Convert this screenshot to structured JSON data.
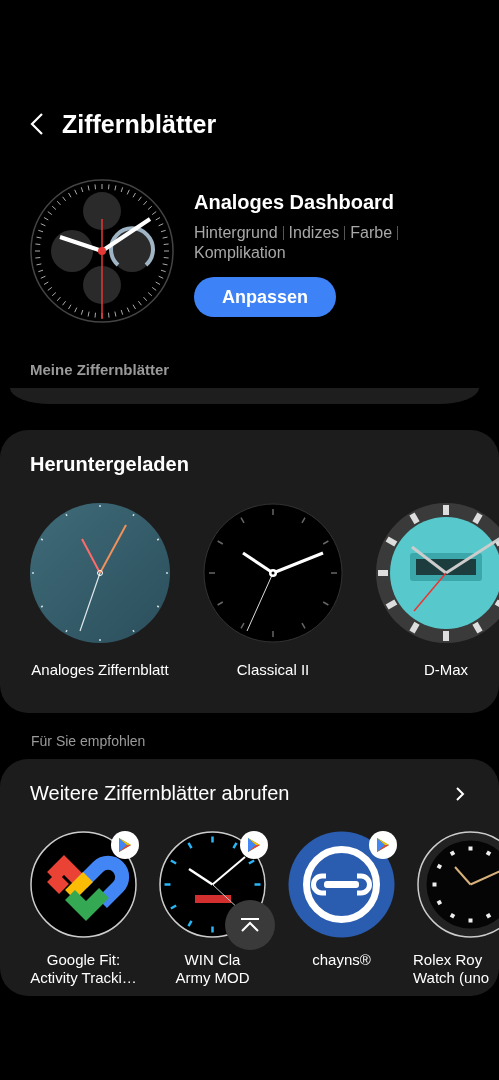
{
  "header": {
    "title": "Ziffernblätter"
  },
  "current": {
    "name": "Analoges Dashboard",
    "options": [
      "Hintergrund",
      "Indizes",
      "Farbe",
      "Komplikation"
    ],
    "button": "Anpassen"
  },
  "my_faces": {
    "heading": "Meine Ziffernblätter"
  },
  "downloaded": {
    "heading": "Heruntergeladen",
    "faces": [
      {
        "name": "Analoges Ziffernblatt",
        "kind": "teal"
      },
      {
        "name": "Classical II",
        "kind": "black"
      },
      {
        "name": "D-Max",
        "kind": "digital"
      }
    ]
  },
  "recommended": {
    "heading": "Für Sie empfohlen",
    "title": "Weitere Ziffernblätter abrufen",
    "apps": [
      {
        "lines": [
          "Google Fit:",
          "Activity Tracki…"
        ],
        "kind": "fit"
      },
      {
        "lines": [
          "WIN Cla",
          "Army MOD"
        ],
        "kind": "sport"
      },
      {
        "lines": [
          "chayns®"
        ],
        "kind": "chain"
      },
      {
        "lines": [
          "Rolex Roy",
          "Watch (uno"
        ],
        "kind": "luxury"
      }
    ]
  }
}
